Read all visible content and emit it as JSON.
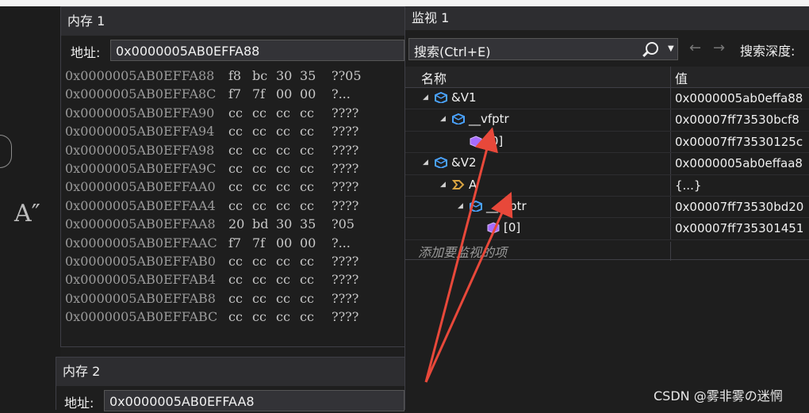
{
  "memory1": {
    "title": "内存 1",
    "address_label": "地址:",
    "address_value": "0x0000005AB0EFFA88",
    "rows": [
      {
        "addr": "0x0000005AB0EFFA88",
        "b1": "f8",
        "b2": "bc",
        "b3": "30",
        "b4": "35",
        "ascii": "??05"
      },
      {
        "addr": "0x0000005AB0EFFA8C",
        "b1": "f7",
        "b2": "7f",
        "b3": "00",
        "b4": "00",
        "ascii": "?..."
      },
      {
        "addr": "0x0000005AB0EFFA90",
        "b1": "cc",
        "b2": "cc",
        "b3": "cc",
        "b4": "cc",
        "ascii": "????"
      },
      {
        "addr": "0x0000005AB0EFFA94",
        "b1": "cc",
        "b2": "cc",
        "b3": "cc",
        "b4": "cc",
        "ascii": "????"
      },
      {
        "addr": "0x0000005AB0EFFA98",
        "b1": "cc",
        "b2": "cc",
        "b3": "cc",
        "b4": "cc",
        "ascii": "????"
      },
      {
        "addr": "0x0000005AB0EFFA9C",
        "b1": "cc",
        "b2": "cc",
        "b3": "cc",
        "b4": "cc",
        "ascii": "????"
      },
      {
        "addr": "0x0000005AB0EFFAA0",
        "b1": "cc",
        "b2": "cc",
        "b3": "cc",
        "b4": "cc",
        "ascii": "????"
      },
      {
        "addr": "0x0000005AB0EFFAA4",
        "b1": "cc",
        "b2": "cc",
        "b3": "cc",
        "b4": "cc",
        "ascii": "????"
      },
      {
        "addr": "0x0000005AB0EFFAA8",
        "b1": "20",
        "b2": "bd",
        "b3": "30",
        "b4": "35",
        "ascii": " ?05"
      },
      {
        "addr": "0x0000005AB0EFFAAC",
        "b1": "f7",
        "b2": "7f",
        "b3": "00",
        "b4": "00",
        "ascii": "?..."
      },
      {
        "addr": "0x0000005AB0EFFAB0",
        "b1": "cc",
        "b2": "cc",
        "b3": "cc",
        "b4": "cc",
        "ascii": "????"
      },
      {
        "addr": "0x0000005AB0EFFAB4",
        "b1": "cc",
        "b2": "cc",
        "b3": "cc",
        "b4": "cc",
        "ascii": "????"
      },
      {
        "addr": "0x0000005AB0EFFAB8",
        "b1": "cc",
        "b2": "cc",
        "b3": "cc",
        "b4": "cc",
        "ascii": "????"
      },
      {
        "addr": "0x0000005AB0EFFABC",
        "b1": "cc",
        "b2": "cc",
        "b3": "cc",
        "b4": "cc",
        "ascii": "????"
      }
    ]
  },
  "memory2": {
    "title": "内存 2",
    "address_label": "地址:",
    "address_value": "0x0000005AB0EFFAA8"
  },
  "watch": {
    "title": "监视 1",
    "search_placeholder": "搜索(Ctrl+E)",
    "search_icon": "magnifier-icon",
    "nav_back": "←",
    "nav_forward": "→",
    "depth_label": "搜索深度:",
    "col_name": "名称",
    "col_value": "值",
    "rows": [
      {
        "indent": 0,
        "expander": "◢",
        "icon": "cube-blue",
        "name": "&V1",
        "value": "0x0000005ab0effa88"
      },
      {
        "indent": 1,
        "expander": "◢",
        "icon": "cube-blue",
        "name": "__vfptr",
        "value": "0x00007ff73530bcf8"
      },
      {
        "indent": 2,
        "expander": "",
        "icon": "cube-purple",
        "name": "[0]",
        "value": "0x00007ff73530125c"
      },
      {
        "indent": 0,
        "expander": "◢",
        "icon": "cube-blue",
        "name": "&V2",
        "value": "0x0000005ab0effaa8"
      },
      {
        "indent": 1,
        "expander": "◢",
        "icon": "class-gold",
        "name": "A",
        "value": "{...}"
      },
      {
        "indent": 2,
        "expander": "◢",
        "icon": "cube-blue",
        "name": "__vfptr",
        "value": "0x00007ff73530bd20"
      },
      {
        "indent": 3,
        "expander": "",
        "icon": "cube-purple",
        "name": "[0]",
        "value": "0x00007ff735301451"
      }
    ],
    "add_item_label": "添加要监视的项"
  },
  "left_glyph": "A″",
  "watermark": "CSDN @雾非雾の迷惘",
  "colors": {
    "arrow": "#e8483a",
    "cube_blue": "#4aa3ff",
    "cube_purple": "#a66cff",
    "class_gold": "#d9a441"
  }
}
